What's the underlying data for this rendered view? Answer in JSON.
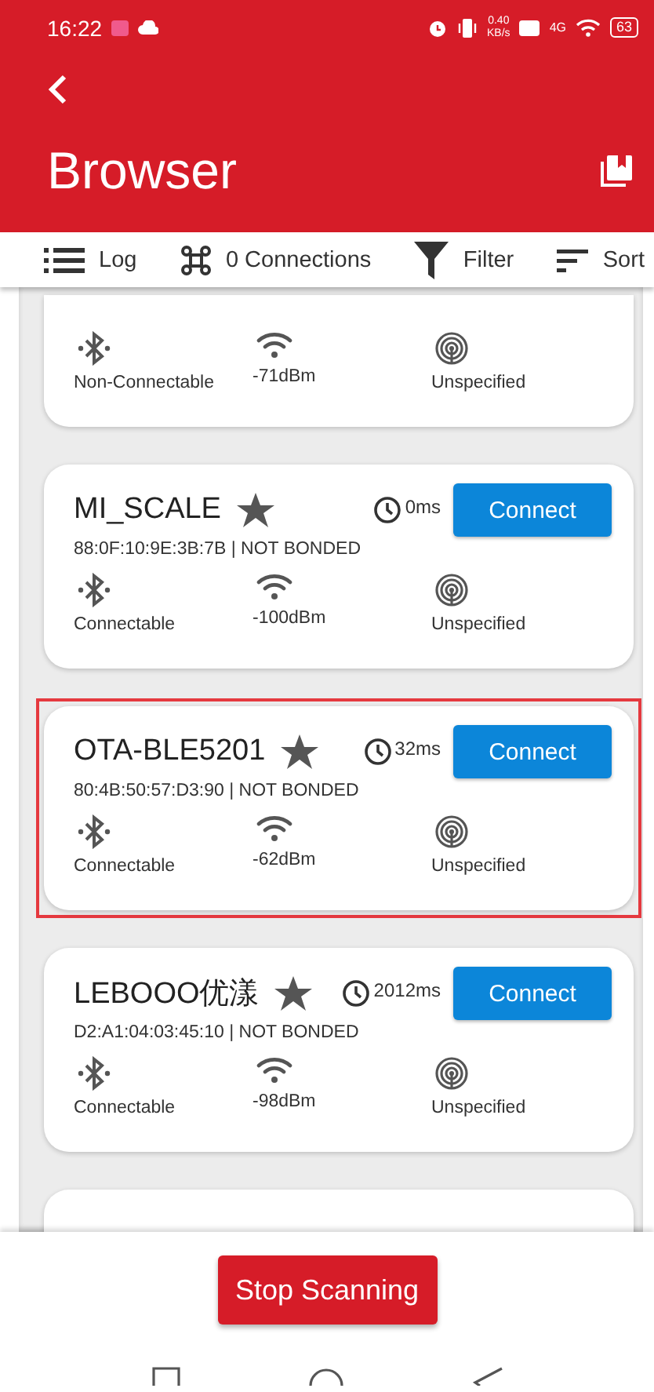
{
  "status_bar": {
    "time": "16:22",
    "speed": "0.40",
    "speed_unit": "KB/s",
    "network": "4G",
    "battery": "63"
  },
  "toolbar": {
    "title": "Browser"
  },
  "actions": [
    {
      "kind": "log",
      "label": "Log"
    },
    {
      "kind": "connections",
      "label": "0 Connections"
    },
    {
      "kind": "filter",
      "label": "Filter"
    },
    {
      "kind": "sort",
      "label": "Sort"
    }
  ],
  "devices": [
    {
      "kind": "partial",
      "highlighted": false,
      "connectable": "Non-Connectable",
      "rssi": "-71dBm",
      "beacon": "Unspecified"
    },
    {
      "kind": "full",
      "highlighted": false,
      "name": "MI_SCALE",
      "interval": "0ms",
      "button": "Connect",
      "address": "88:0F:10:9E:3B:7B | NOT BONDED",
      "connectable": "Connectable",
      "rssi": "-100dBm",
      "beacon": "Unspecified"
    },
    {
      "kind": "full",
      "highlighted": true,
      "name": "OTA-BLE5201",
      "interval": "32ms",
      "button": "Connect",
      "address": "80:4B:50:57:D3:90 | NOT BONDED",
      "connectable": "Connectable",
      "rssi": "-62dBm",
      "beacon": "Unspecified"
    },
    {
      "kind": "full",
      "highlighted": false,
      "name": "LEBOOO优漾",
      "interval": "2012ms",
      "button": "Connect",
      "address": "D2:A1:04:03:45:10 | NOT BONDED",
      "connectable": "Connectable",
      "rssi": "-98dBm",
      "beacon": "Unspecified"
    },
    {
      "kind": "empty",
      "highlighted": false
    }
  ],
  "stop_button": "Stop Scanning"
}
